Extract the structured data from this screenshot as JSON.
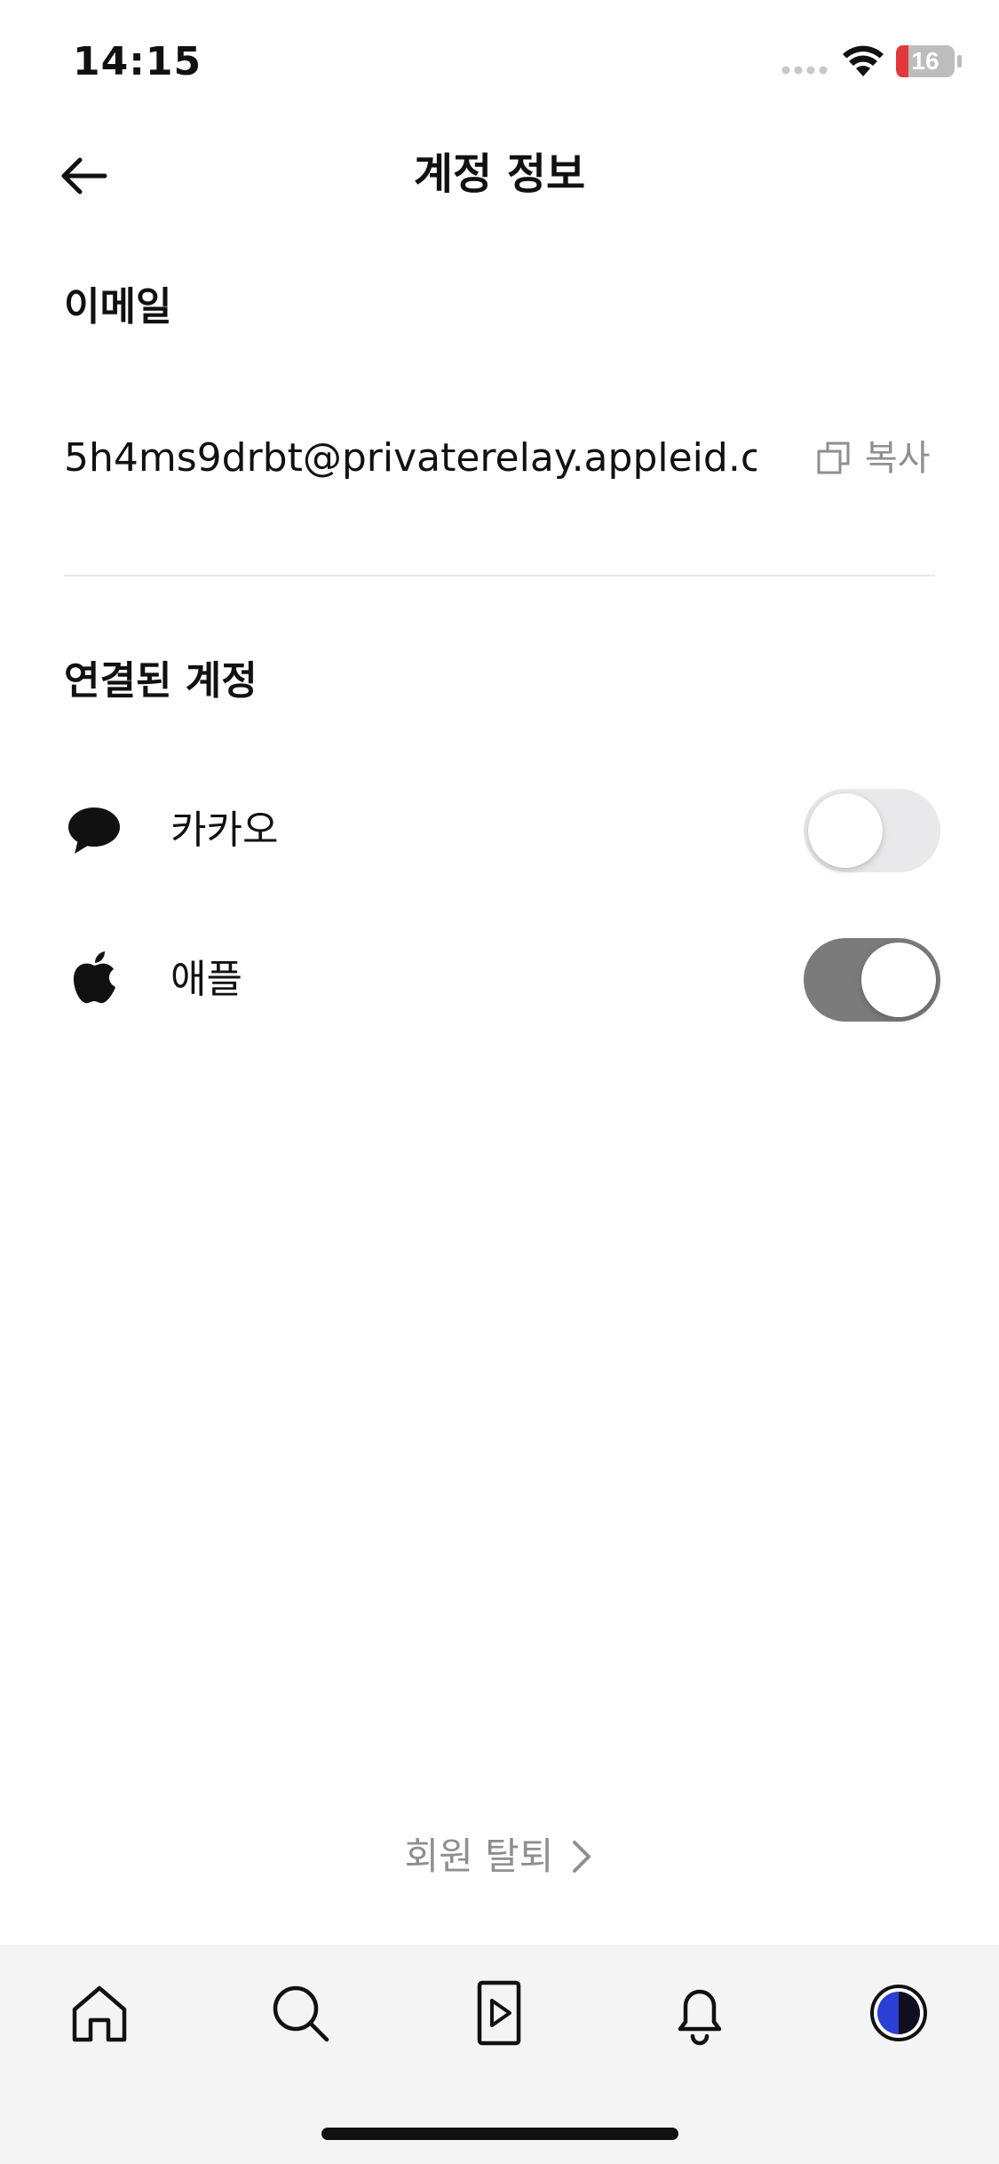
{
  "status_bar": {
    "time": "14:15",
    "battery": "16",
    "icons": [
      "signal-dots-icon",
      "wifi-icon",
      "battery-icon"
    ]
  },
  "header": {
    "title": "계정 정보",
    "back_icon": "arrow-left-icon"
  },
  "email_section": {
    "title": "이메일",
    "value": "5h4ms9drbt@privaterelay.appleid.c...",
    "copy_label": "복사",
    "copy_icon": "copy-icon"
  },
  "linked_section": {
    "title": "연결된 계정",
    "accounts": [
      {
        "label": "카카오",
        "icon": "speech-bubble-icon",
        "enabled": false
      },
      {
        "label": "애플",
        "icon": "apple-logo-icon",
        "enabled": true
      }
    ]
  },
  "withdraw": {
    "label": "회원 탈퇴",
    "icon": "chevron-right-icon"
  },
  "tab_bar": {
    "tabs": [
      {
        "name": "home",
        "icon": "home-icon"
      },
      {
        "name": "search",
        "icon": "search-icon"
      },
      {
        "name": "video",
        "icon": "video-play-icon"
      },
      {
        "name": "notifications",
        "icon": "bell-icon"
      },
      {
        "name": "profile",
        "icon": "profile-avatar-icon"
      }
    ]
  },
  "colors": {
    "text_primary": "#111111",
    "text_secondary": "#8e8e93",
    "toggle_on": "#7b7b7b",
    "toggle_off": "#e9e9eb",
    "battery_low": "#e5383b",
    "avatar_blue": "#2b3fd6"
  }
}
